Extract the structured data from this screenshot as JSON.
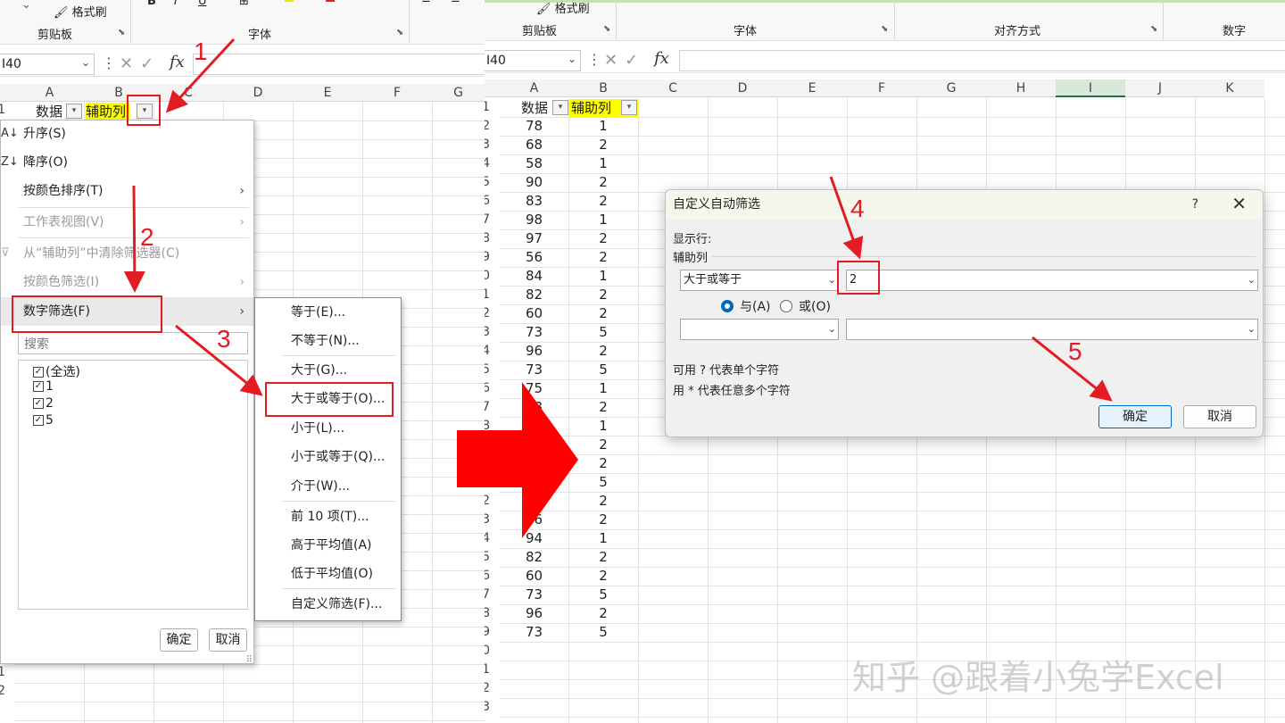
{
  "left": {
    "ribbon": {
      "format_painter": "格式刷",
      "clipboard": "剪贴板",
      "font": "字体"
    },
    "name_box": "I40",
    "fx_label": "fx",
    "columns": [
      "A",
      "B",
      "C",
      "D",
      "E",
      "F",
      "G"
    ],
    "header": {
      "col_a": "数据",
      "col_b": "辅助列"
    },
    "row_numbers": [
      "1",
      "1",
      "2"
    ],
    "menu": {
      "sort_asc": "升序(S)",
      "sort_desc": "降序(O)",
      "sort_color": "按颜色排序(T)",
      "sheet_view": "工作表视图(V)",
      "clear_filter": "从“辅助列”中清除筛选器(C)",
      "filter_color": "按颜色筛选(I)",
      "number_filter": "数字筛选(F)",
      "search_placeholder": "搜索",
      "checklist": [
        "(全选)",
        "1",
        "2",
        "5"
      ],
      "ok": "确定",
      "cancel": "取消"
    },
    "submenu": [
      "等于(E)...",
      "不等于(N)...",
      "大于(G)...",
      "大于或等于(O)...",
      "小于(L)...",
      "小于或等于(Q)...",
      "介于(W)...",
      "前 10 项(T)...",
      "高于平均值(A)",
      "低于平均值(O)",
      "自定义筛选(F)..."
    ]
  },
  "right": {
    "ribbon": {
      "format_painter": "格式刷",
      "clipboard": "剪贴板",
      "font": "字体",
      "alignment": "对齐方式",
      "number": "数字"
    },
    "name_box": "I40",
    "fx_label": "fx",
    "columns": [
      "A",
      "B",
      "C",
      "D",
      "E",
      "F",
      "G",
      "H",
      "I",
      "J",
      "K"
    ],
    "header": {
      "col_a": "数据",
      "col_b": "辅助列"
    },
    "rows": [
      {
        "n": "1",
        "a": "",
        "b": ""
      },
      {
        "n": "2",
        "a": "78",
        "b": "1"
      },
      {
        "n": "3",
        "a": "68",
        "b": "2"
      },
      {
        "n": "4",
        "a": "58",
        "b": "1"
      },
      {
        "n": "5",
        "a": "90",
        "b": "2"
      },
      {
        "n": "6",
        "a": "83",
        "b": "2"
      },
      {
        "n": "7",
        "a": "98",
        "b": "1"
      },
      {
        "n": "8",
        "a": "97",
        "b": "2"
      },
      {
        "n": "9",
        "a": "56",
        "b": "2"
      },
      {
        "n": "0",
        "a": "84",
        "b": "1"
      },
      {
        "n": "1",
        "a": "82",
        "b": "2"
      },
      {
        "n": "2",
        "a": "60",
        "b": "2"
      },
      {
        "n": "3",
        "a": "73",
        "b": "5"
      },
      {
        "n": "4",
        "a": "96",
        "b": "2"
      },
      {
        "n": "5",
        "a": "73",
        "b": "5"
      },
      {
        "n": "6",
        "a": "75",
        "b": "1"
      },
      {
        "n": "7",
        "a": "68",
        "b": "2"
      },
      {
        "n": "8",
        "a": "",
        "b": "1"
      },
      {
        "n": "",
        "a": "",
        "b": "2"
      },
      {
        "n": "",
        "a": "",
        "b": "2"
      },
      {
        "n": "1",
        "a": "",
        "b": "5"
      },
      {
        "n": "2",
        "a": "97",
        "b": "2"
      },
      {
        "n": "3",
        "a": "56",
        "b": "2"
      },
      {
        "n": "4",
        "a": "94",
        "b": "1"
      },
      {
        "n": "5",
        "a": "82",
        "b": "2"
      },
      {
        "n": "6",
        "a": "60",
        "b": "2"
      },
      {
        "n": "7",
        "a": "73",
        "b": "5"
      },
      {
        "n": "8",
        "a": "96",
        "b": "2"
      },
      {
        "n": "9",
        "a": "73",
        "b": "5"
      },
      {
        "n": "0",
        "a": "",
        "b": ""
      },
      {
        "n": "1",
        "a": "",
        "b": ""
      },
      {
        "n": "2",
        "a": "",
        "b": ""
      },
      {
        "n": "3",
        "a": "",
        "b": ""
      }
    ],
    "dialog": {
      "title": "自定义自动筛选",
      "help": "?",
      "close": "✕",
      "show_rows": "显示行:",
      "field": "辅助列",
      "operator1": "大于或等于",
      "value1": "2",
      "and_label": "与(A)",
      "or_label": "或(O)",
      "operator2": "",
      "value2": "",
      "hint1": "可用 ? 代表单个字符",
      "hint2": "用 * 代表任意多个字符",
      "ok": "确定",
      "cancel": "取消"
    }
  },
  "annotations": [
    "1",
    "2",
    "3",
    "4",
    "5"
  ],
  "watermark": "知乎 @跟着小兔学Excel",
  "colors": {
    "annotation_red": "#e31c23",
    "header_yellow": "#ffff00",
    "accent_blue": "#0067c0"
  }
}
